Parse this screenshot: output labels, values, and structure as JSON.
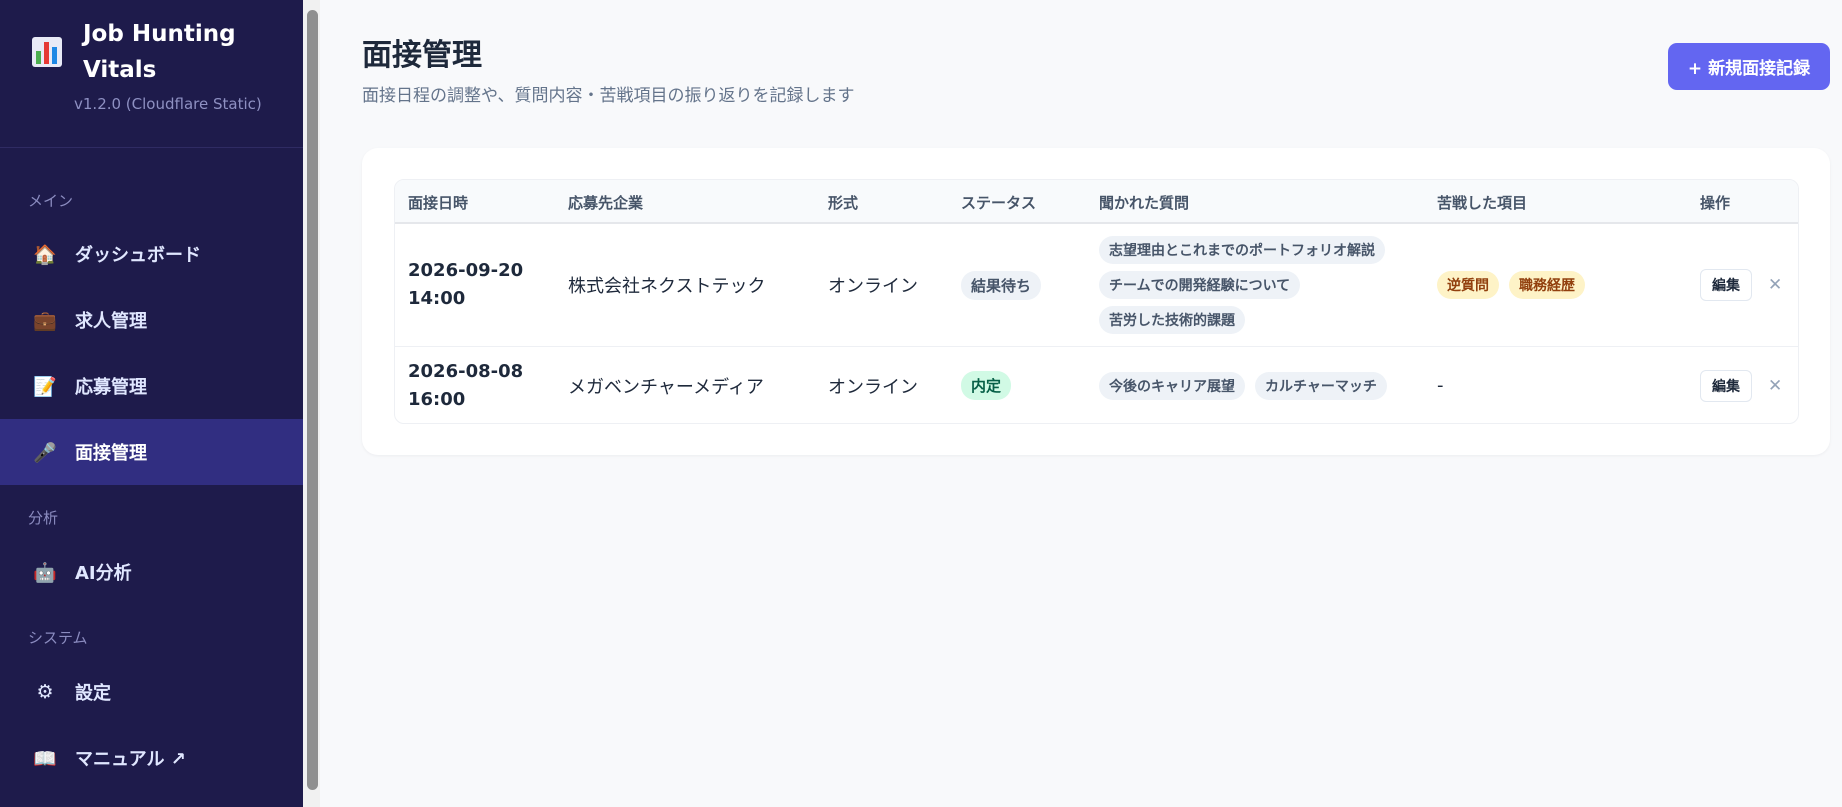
{
  "app": {
    "name": "Job Hunting Vitals",
    "version": "v1.2.0 (Cloudflare Static)"
  },
  "sidebar": {
    "sections": [
      {
        "label": "メイン"
      },
      {
        "label": "分析"
      },
      {
        "label": "システム"
      }
    ],
    "items": [
      {
        "label": "ダッシュボード",
        "icon": "house-icon",
        "glyph": "🏠"
      },
      {
        "label": "求人管理",
        "icon": "briefcase-icon",
        "glyph": "💼"
      },
      {
        "label": "応募管理",
        "icon": "document-pen-icon",
        "glyph": "📝"
      },
      {
        "label": "面接管理",
        "icon": "handshake-icon",
        "glyph": "🎤",
        "active": true
      },
      {
        "label": "AI分析",
        "icon": "robot-icon",
        "glyph": "🤖"
      },
      {
        "label": "設定",
        "icon": "gear-icon",
        "glyph": "⚙"
      },
      {
        "label": "マニュアル ↗",
        "icon": "book-icon",
        "glyph": "📖"
      }
    ]
  },
  "page": {
    "title": "面接管理",
    "subtitle": "面接日程の調整や、質問内容・苦戦項目の振り返りを記録します",
    "new_button": "+ 新規面接記録"
  },
  "table": {
    "headers": [
      "面接日時",
      "応募先企業",
      "形式",
      "ステータス",
      "聞かれた質問",
      "苦戦した項目",
      "操作"
    ],
    "rows": [
      {
        "date": "2026-09-20",
        "time": "14:00",
        "company": "株式会社ネクストテック",
        "format": "オンライン",
        "status": "結果待ち",
        "questions": [
          "志望理由とこれまでのポートフォリオ解説",
          "チームでの開発経験について",
          "苦労した技術的課題"
        ],
        "struggles": [
          "逆質問",
          "職務経歴"
        ],
        "edit": "編集",
        "delete": "✕"
      },
      {
        "date": "2026-08-08",
        "time": "16:00",
        "company": "メガベンチャーメディア",
        "format": "オンライン",
        "status": "内定",
        "questions": [
          "今後のキャリア展望",
          "カルチャーマッチ"
        ],
        "struggles_empty": "-",
        "edit": "編集",
        "delete": "✕"
      }
    ]
  },
  "colors": {
    "sidebar_bg": "#1e1b4b",
    "sidebar_active": "#312e81",
    "accent": "#6366f1",
    "offer_bg": "#d1fae5",
    "warn_bg": "#fef3c7"
  }
}
